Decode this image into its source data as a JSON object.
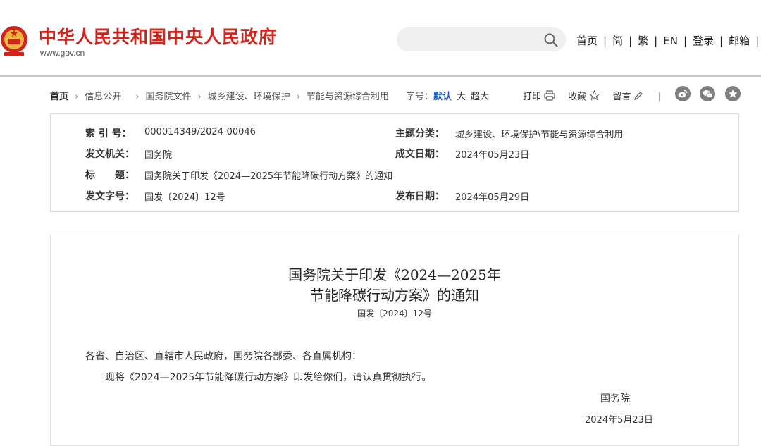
{
  "header": {
    "site_title": "中华人民共和国中央人民政府",
    "site_domain": "www.gov.cn",
    "search": {
      "placeholder": ""
    },
    "nav": [
      "首页",
      "简",
      "繁",
      "EN",
      "登录",
      "邮箱"
    ]
  },
  "breadcrumb": {
    "items": [
      "首页",
      "信息公开",
      "国务院文件",
      "城乡建设、环境保护",
      "节能与资源综合利用"
    ]
  },
  "font_size": {
    "label": "字号：",
    "options": [
      "默认",
      "大",
      "超大"
    ],
    "selected": "默认"
  },
  "tools": {
    "print": "打印",
    "favorite": "收藏",
    "comment": "留言"
  },
  "share": [
    "weibo-icon",
    "wechat-icon",
    "qzone-icon"
  ],
  "info": {
    "index_label": "索 引 号：",
    "index_value": "000014349/2024-00046",
    "category_label": "主题分类：",
    "category_value": "城乡建设、环境保护\\节能与资源综合利用",
    "issuer_label": "发文机关：",
    "issuer_value": "国务院",
    "written_label": "成文日期：",
    "written_value": "2024年05月23日",
    "title_label": "标　　题：",
    "title_value": "国务院关于印发《2024—2025年节能降碳行动方案》的通知",
    "docno_label": "发文字号：",
    "docno_value": "国发〔2024〕12号",
    "published_label": "发布日期：",
    "published_value": "2024年05月29日"
  },
  "document": {
    "title_line1": "国务院关于印发《2024—2025年",
    "title_line2": "节能降碳行动方案》的通知",
    "number": "国发〔2024〕12号",
    "salutation": "各省、自治区、直辖市人民政府，国务院各部委、各直属机构：",
    "body": "现将《2024—2025年节能降碳行动方案》印发给你们，请认真贯彻执行。",
    "signer": "国务院",
    "date": "2024年5月23日"
  },
  "colors": {
    "brand_red": "#d0241c",
    "link_blue": "#1f5fbf"
  }
}
